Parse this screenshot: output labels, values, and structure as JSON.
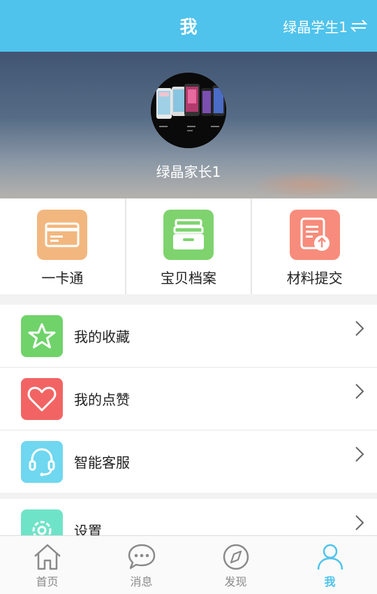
{
  "header": {
    "title": "我",
    "switch_label": "绿晶学生1"
  },
  "profile": {
    "name": "绿晶家长1"
  },
  "quick": [
    {
      "label": "一卡通",
      "icon": "card-icon",
      "color": "#f2b77f"
    },
    {
      "label": "宝贝档案",
      "icon": "archive-box-icon",
      "color": "#7ed36e"
    },
    {
      "label": "材料提交",
      "icon": "document-upload-icon",
      "color": "#f78c7c"
    }
  ],
  "menu": [
    {
      "label": "我的收藏",
      "icon": "star-icon",
      "color": "#6fd36a"
    },
    {
      "label": "我的点赞",
      "icon": "heart-icon",
      "color": "#f26464"
    },
    {
      "label": "智能客服",
      "icon": "headset-icon",
      "color": "#6fd7ef"
    },
    {
      "label": "设置",
      "icon": "gear-icon",
      "color": "#6fe3c8"
    }
  ],
  "tabs": [
    {
      "label": "首页",
      "icon": "home-icon",
      "active": false
    },
    {
      "label": "消息",
      "icon": "chat-bubble-icon",
      "active": false
    },
    {
      "label": "发现",
      "icon": "compass-icon",
      "active": false
    },
    {
      "label": "我",
      "icon": "person-icon",
      "active": true
    }
  ],
  "colors": {
    "accent": "#4fc3ec",
    "tab_inactive": "#8a8a8a"
  }
}
